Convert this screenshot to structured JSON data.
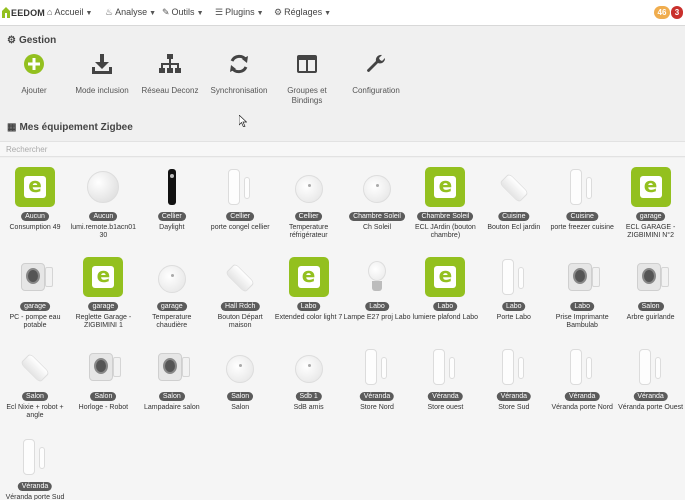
{
  "navbar": {
    "brand_text": "EEDOM",
    "items": [
      {
        "label": "Accueil",
        "icon": "home-icon",
        "glyph": "⌂"
      },
      {
        "label": "Analyse",
        "icon": "analysis-icon",
        "glyph": "♨"
      },
      {
        "label": "Outils",
        "icon": "wrench-icon",
        "glyph": "✎"
      },
      {
        "label": "Plugins",
        "icon": "tasks-icon",
        "glyph": "☰"
      },
      {
        "label": "Réglages",
        "icon": "gears-icon",
        "glyph": "⚙"
      }
    ],
    "badges": [
      {
        "value": "46",
        "color": "#f0ad4e"
      },
      {
        "value": "3",
        "color": "#c9302c"
      }
    ]
  },
  "gestion": {
    "title": "Gestion",
    "actions": [
      {
        "label": "Ajouter",
        "icon": "add-icon"
      },
      {
        "label": "Mode inclusion",
        "icon": "download-icon"
      },
      {
        "label": "Réseau Deconz",
        "icon": "network-icon"
      },
      {
        "label": "Synchronisation",
        "icon": "sync-icon"
      },
      {
        "label": "Groupes et Bindings",
        "icon": "columns-icon"
      },
      {
        "label": "Configuration",
        "icon": "wrench-icon"
      }
    ]
  },
  "equipment": {
    "title": "Mes équipement Zigbee",
    "search_placeholder": "Rechercher",
    "devices": [
      {
        "room": "Aucun",
        "name": "Consumption 49",
        "thumb": "enedis"
      },
      {
        "room": "Aucun",
        "name": "lumi.remote.b1acn01 30",
        "thumb": "ball"
      },
      {
        "room": "Cellier",
        "name": "Daylight",
        "thumb": "remote"
      },
      {
        "room": "Cellier",
        "name": "porte congel cellier",
        "thumb": "contact"
      },
      {
        "room": "Cellier",
        "name": "Temperature réfrigérateur",
        "thumb": "disc"
      },
      {
        "room": "Chambre Soleil",
        "name": "Ch Soleil",
        "thumb": "disc"
      },
      {
        "room": "Chambre Soleil",
        "name": "ECL JArdin (bouton chambre)",
        "thumb": "enedis"
      },
      {
        "room": "Cuisine",
        "name": "Bouton Ecl jardin",
        "thumb": "square"
      },
      {
        "room": "Cuisine",
        "name": "porte freezer cuisine",
        "thumb": "contact"
      },
      {
        "room": "garage",
        "name": "ECL GARAGE - ZIGBIMINI N°2",
        "thumb": "enedis"
      },
      {
        "room": "garage",
        "name": "PC - pompe eau potable",
        "thumb": "plug"
      },
      {
        "room": "garage",
        "name": "Reglette Garage - ZIGBIMINI 1",
        "thumb": "enedis"
      },
      {
        "room": "garage",
        "name": "Temperature chaudière",
        "thumb": "disc"
      },
      {
        "room": "Hall Rdch",
        "name": "Bouton Départ maison",
        "thumb": "square"
      },
      {
        "room": "Labo",
        "name": "Extended color light 7",
        "thumb": "enedis"
      },
      {
        "room": "Labo",
        "name": "Lampe E27 proj Labo",
        "thumb": "bulb"
      },
      {
        "room": "Labo",
        "name": "lumiere plafond Labo",
        "thumb": "enedis"
      },
      {
        "room": "Labo",
        "name": "Porte Labo",
        "thumb": "contact"
      },
      {
        "room": "Labo",
        "name": "Prise Imprimante Bambulab",
        "thumb": "plug"
      },
      {
        "room": "Salon",
        "name": "Arbre guirlande",
        "thumb": "plug"
      },
      {
        "room": "Salon",
        "name": "Ecl Nixie + robot + angle",
        "thumb": "square"
      },
      {
        "room": "Salon",
        "name": "Horloge - Robot",
        "thumb": "plug"
      },
      {
        "room": "Salon",
        "name": "Lampadaire salon",
        "thumb": "plug"
      },
      {
        "room": "Salon",
        "name": "Salon",
        "thumb": "disc"
      },
      {
        "room": "Sdb 1",
        "name": "SdB amis",
        "thumb": "disc"
      },
      {
        "room": "Véranda",
        "name": "Store Nord",
        "thumb": "contact"
      },
      {
        "room": "Véranda",
        "name": "Store ouest",
        "thumb": "contact"
      },
      {
        "room": "Véranda",
        "name": "Store Sud",
        "thumb": "contact"
      },
      {
        "room": "Véranda",
        "name": "Véranda porte Nord",
        "thumb": "contact"
      },
      {
        "room": "Véranda",
        "name": "Véranda porte Ouest",
        "thumb": "contact"
      },
      {
        "room": "Véranda",
        "name": "Véranda porte Sud",
        "thumb": "contact"
      }
    ]
  },
  "colors": {
    "accent_green": "#93c01f",
    "badge_room": "#5b5b5b"
  }
}
